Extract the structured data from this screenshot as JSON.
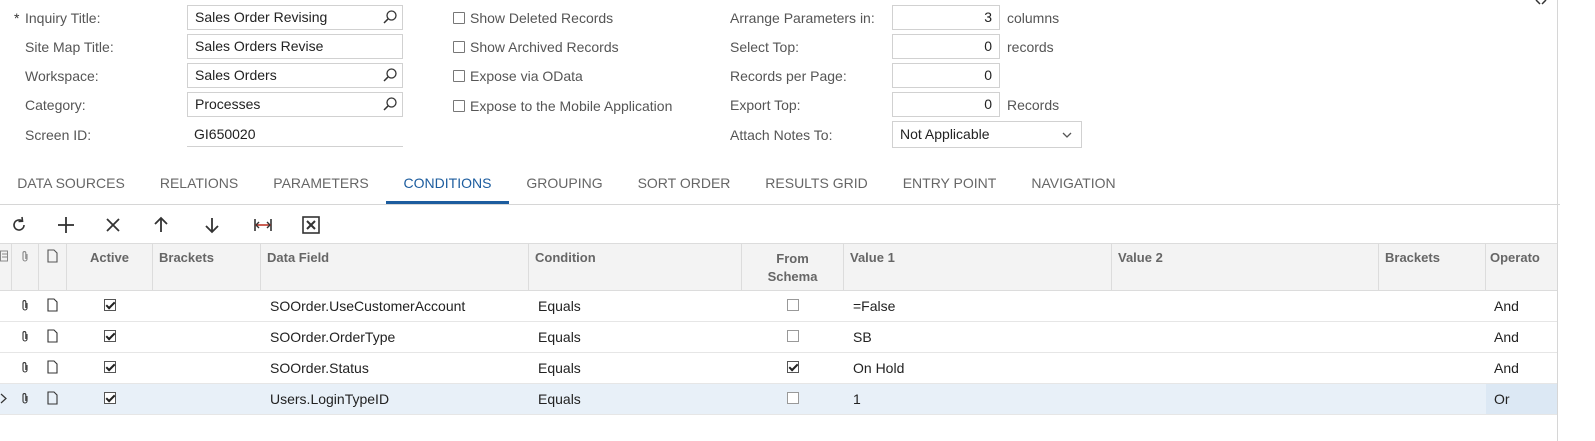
{
  "form": {
    "required_mark": "*",
    "inquiry_title_label": "Inquiry Title:",
    "inquiry_title_value": "Sales Order Revising",
    "site_map_title_label": "Site Map Title:",
    "site_map_title_value": "Sales Orders Revise",
    "workspace_label": "Workspace:",
    "workspace_value": "Sales Orders",
    "category_label": "Category:",
    "category_value": "Processes",
    "screen_id_label": "Screen ID:",
    "screen_id_value": "GI650020"
  },
  "options": {
    "show_deleted": "Show Deleted Records",
    "show_archived": "Show Archived Records",
    "expose_odata": "Expose via OData",
    "expose_mobile": "Expose to the Mobile Application"
  },
  "params": {
    "arrange_label": "Arrange Parameters in:",
    "arrange_value": "3",
    "arrange_unit": "columns",
    "select_top_label": "Select Top:",
    "select_top_value": "0",
    "select_top_unit": "records",
    "records_per_page_label": "Records per Page:",
    "records_per_page_value": "0",
    "export_top_label": "Export Top:",
    "export_top_value": "0",
    "export_top_unit": "Records",
    "attach_notes_label": "Attach Notes To:",
    "attach_notes_value": "Not Applicable"
  },
  "tabs": [
    {
      "label": "DATA SOURCES"
    },
    {
      "label": "RELATIONS"
    },
    {
      "label": "PARAMETERS"
    },
    {
      "label": "CONDITIONS",
      "active": true
    },
    {
      "label": "GROUPING"
    },
    {
      "label": "SORT ORDER"
    },
    {
      "label": "RESULTS GRID"
    },
    {
      "label": "ENTRY POINT"
    },
    {
      "label": "NAVIGATION"
    }
  ],
  "toolbar": [
    "refresh-icon",
    "add-icon",
    "delete-icon",
    "move-up-icon",
    "move-down-icon",
    "fit-columns-icon",
    "export-excel-icon"
  ],
  "grid": {
    "headers": {
      "active": "Active",
      "brackets_open": "Brackets",
      "data_field": "Data Field",
      "condition": "Condition",
      "from_schema_1": "From",
      "from_schema_2": "Schema",
      "value1": "Value 1",
      "value2": "Value 2",
      "brackets_close": "Brackets",
      "operator": "Operato"
    },
    "rows": [
      {
        "active": true,
        "data_field": "SOOrder.UseCustomerAccount",
        "condition": "Equals",
        "from_schema": false,
        "value1": "=False",
        "value2": "",
        "operator": "And"
      },
      {
        "active": true,
        "data_field": "SOOrder.OrderType",
        "condition": "Equals",
        "from_schema": false,
        "value1": "SB",
        "value2": "",
        "operator": "And"
      },
      {
        "active": true,
        "data_field": "SOOrder.Status",
        "condition": "Equals",
        "from_schema": true,
        "value1": "On Hold",
        "value2": "",
        "operator": "And"
      },
      {
        "active": true,
        "data_field": "Users.LoginTypeID",
        "condition": "Equals",
        "from_schema": false,
        "value1": "1",
        "value2": "",
        "operator": "Or",
        "selected": true
      }
    ]
  },
  "colors": {
    "accent": "#1c5c9e",
    "selected_row": "#e8f0f8"
  }
}
